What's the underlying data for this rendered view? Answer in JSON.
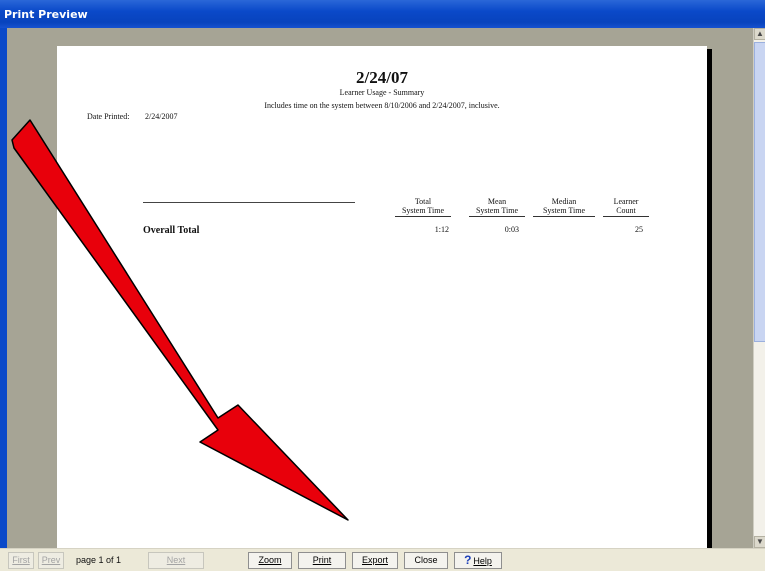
{
  "window": {
    "title": "Print Preview"
  },
  "report": {
    "heading_date": "2/24/07",
    "subtitle": "Learner Usage - Summary",
    "range_text": "Includes time on the system between 8/10/2006 and 2/24/2007, inclusive.",
    "date_printed_label": "Date Printed:",
    "date_printed_value": "2/24/2007",
    "columns": [
      {
        "line1": "Total",
        "line2": "System Time"
      },
      {
        "line1": "Mean",
        "line2": "System Time"
      },
      {
        "line1": "Median",
        "line2": "System Time"
      },
      {
        "line1": "Learner",
        "line2": "Count"
      }
    ],
    "row": {
      "label": "Overall Total",
      "total": "1:12",
      "mean": "0:03",
      "median": "",
      "count": "25"
    }
  },
  "toolbar": {
    "first": "First",
    "prev": "Prev",
    "page_indicator": "page 1 of 1",
    "next": "Next",
    "zoom": "Zoom",
    "print": "Print",
    "export": "Export",
    "close": "Close",
    "help": "Help"
  },
  "colors": {
    "title_bar": "#0a49c9",
    "canvas": "#a6a495",
    "arrow": "#e8000b",
    "toolbar": "#ece9d8"
  }
}
